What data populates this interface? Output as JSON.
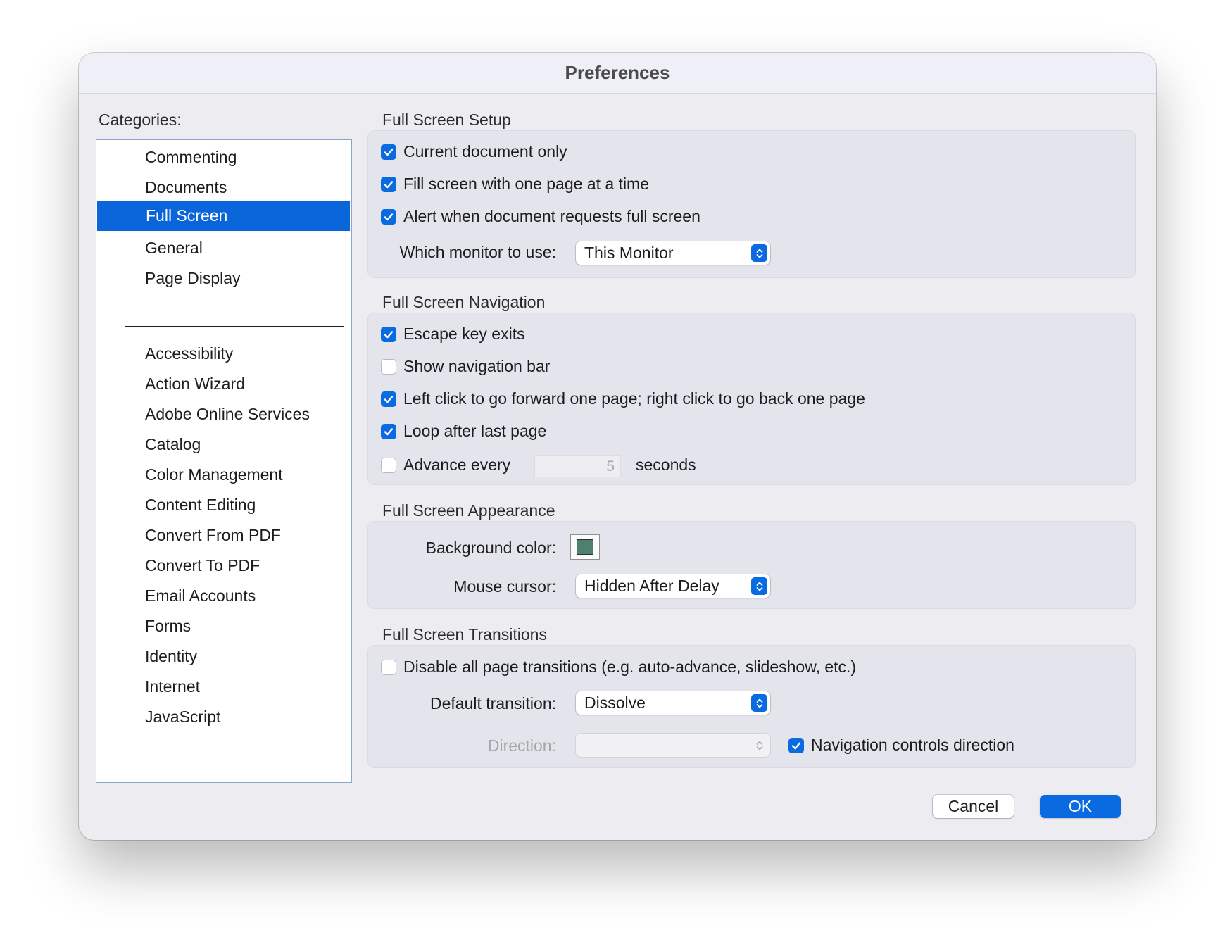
{
  "window": {
    "title": "Preferences"
  },
  "sidebar": {
    "label": "Categories:",
    "selected": "Full Screen",
    "items_top": [
      "Commenting",
      "Documents",
      "Full Screen",
      "General",
      "Page Display"
    ],
    "items_bottom": [
      "Accessibility",
      "Action Wizard",
      "Adobe Online Services",
      "Catalog",
      "Color Management",
      "Content Editing",
      "Convert From PDF",
      "Convert To PDF",
      "Email Accounts",
      "Forms",
      "Identity",
      "Internet",
      "JavaScript"
    ]
  },
  "setup": {
    "title": "Full Screen Setup",
    "current_document_only": {
      "label": "Current document only",
      "checked": true
    },
    "fill_screen": {
      "label": "Fill screen with one page at a time",
      "checked": true
    },
    "alert_request": {
      "label": "Alert when document requests full screen",
      "checked": true
    },
    "monitor_label": "Which monitor to use:",
    "monitor_value": "This Monitor"
  },
  "navigation": {
    "title": "Full Screen Navigation",
    "escape_exits": {
      "label": "Escape key exits",
      "checked": true
    },
    "show_nav_bar": {
      "label": "Show navigation bar",
      "checked": false
    },
    "left_click": {
      "label": "Left click to go forward one page; right click to go back one page",
      "checked": true
    },
    "loop": {
      "label": "Loop after last page",
      "checked": true
    },
    "advance_every": {
      "label": "Advance every",
      "checked": false
    },
    "advance_value": "5",
    "seconds_label": "seconds"
  },
  "appearance": {
    "title": "Full Screen Appearance",
    "bg_color_label": "Background color:",
    "bg_color": "#4f7f6f",
    "cursor_label": "Mouse cursor:",
    "cursor_value": "Hidden After Delay"
  },
  "transitions": {
    "title": "Full Screen Transitions",
    "disable_all": {
      "label": "Disable all page transitions (e.g. auto-advance, slideshow, etc.)",
      "checked": false
    },
    "default_label": "Default transition:",
    "default_value": "Dissolve",
    "direction_label": "Direction:",
    "direction_value": "",
    "nav_controls": {
      "label": "Navigation controls direction",
      "checked": true
    }
  },
  "buttons": {
    "cancel": "Cancel",
    "ok": "OK"
  },
  "colors": {
    "accent": "#0a6ae0",
    "selection": "#0a64da"
  }
}
